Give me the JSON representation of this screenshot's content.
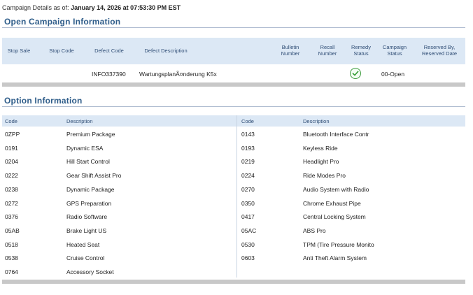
{
  "header": {
    "as_of_label": "Campaign Details as of:",
    "as_of_value": "January 14, 2026 at 07:53:30 PM EST"
  },
  "open_campaign": {
    "title": "Open Campaign Information",
    "columns": [
      "Stop Sale",
      "Stop Code",
      "Defect Code",
      "Defect Description",
      "Bulletin Number",
      "Recall Number",
      "Remedy Status",
      "Campaign Status",
      "Reserved By, Reserved Date"
    ],
    "rows": [
      {
        "stop_sale": "",
        "stop_code": "",
        "defect_code": "INFO337390",
        "defect_description": "WartungsplanÃ¤nderung K5x",
        "bulletin_number": "",
        "recall_number": "",
        "remedy_status_icon": "check-circle-icon",
        "campaign_status": "00-Open",
        "reserved": ""
      }
    ]
  },
  "option_info": {
    "title": "Option Information",
    "left_headers": {
      "code": "Code",
      "description": "Description"
    },
    "right_headers": {
      "code": "Code",
      "description": "Description"
    },
    "left": [
      {
        "code": "0ZPP",
        "description": "Premium Package"
      },
      {
        "code": "0191",
        "description": "Dynamic ESA"
      },
      {
        "code": "0204",
        "description": "Hill Start Control"
      },
      {
        "code": "0222",
        "description": "Gear Shift Assist Pro"
      },
      {
        "code": "0238",
        "description": "Dynamic Package"
      },
      {
        "code": "0272",
        "description": "GPS Preparation"
      },
      {
        "code": "0376",
        "description": "Radio Software"
      },
      {
        "code": "05AB",
        "description": "Brake Light US"
      },
      {
        "code": "0518",
        "description": "Heated Seat"
      },
      {
        "code": "0538",
        "description": "Cruise Control"
      },
      {
        "code": "0764",
        "description": "Accessory Socket"
      }
    ],
    "right": [
      {
        "code": "0143",
        "description": "Bluetooth Interface Contr"
      },
      {
        "code": "0193",
        "description": "Keyless Ride"
      },
      {
        "code": "0219",
        "description": "Headlight Pro"
      },
      {
        "code": "0224",
        "description": "Ride Modes Pro"
      },
      {
        "code": "0270",
        "description": "Audio System with Radio"
      },
      {
        "code": "0350",
        "description": "Chrome Exhaust Pipe"
      },
      {
        "code": "0417",
        "description": "Central Locking System"
      },
      {
        "code": "05AC",
        "description": "ABS Pro"
      },
      {
        "code": "0530",
        "description": "TPM (Tire Pressure Monito"
      },
      {
        "code": "0603",
        "description": "Anti Theft Alarm System"
      }
    ]
  },
  "colors": {
    "accent": "#2f5d8a",
    "header_bg": "#dce8f5",
    "status_ok": "#3c9a3c"
  }
}
